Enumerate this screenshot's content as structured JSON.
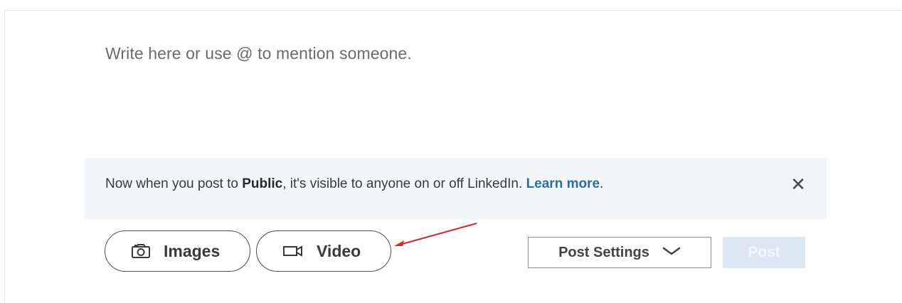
{
  "composer": {
    "placeholder": "Write here or use @ to mention someone."
  },
  "notice": {
    "text_before": "Now when you post to ",
    "strong": "Public",
    "text_middle": ", it's visible to anyone on or off LinkedIn. ",
    "link": "Learn more",
    "text_after": ".",
    "close_glyph": "✕",
    "close_icon": "close-icon"
  },
  "toolbar": {
    "images_label": "Images",
    "images_icon": "camera-icon",
    "video_label": "Video",
    "video_icon": "video-camera-icon",
    "post_settings_label": "Post Settings",
    "post_settings_icon": "chevron-down-icon",
    "post_label": "Post"
  },
  "annotation": {
    "arrow_color": "#d9262c"
  },
  "colors": {
    "link": "#2c6ea3",
    "post_button_disabled": "#dbe8f3",
    "notice_bg": "#f3f6f8"
  }
}
